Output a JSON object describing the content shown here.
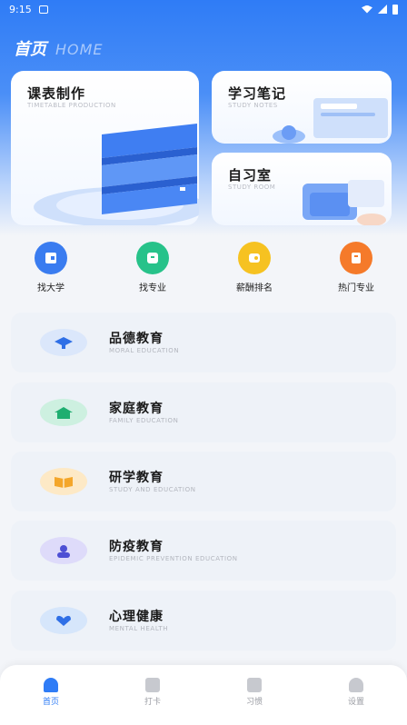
{
  "status": {
    "time": "9:15"
  },
  "header": {
    "title": "首页",
    "title_en": "HOME"
  },
  "cards": {
    "timetable": {
      "title": "课表制作",
      "subtitle": "TIMETABLE PRODUCTION"
    },
    "notes": {
      "title": "学习笔记",
      "subtitle": "STUDY NOTES"
    },
    "room": {
      "title": "自习室",
      "subtitle": "STUDY ROOM"
    }
  },
  "quick": [
    {
      "label": "找大学",
      "color": "#3a7cf0"
    },
    {
      "label": "找专业",
      "color": "#27c28a"
    },
    {
      "label": "薪酬排名",
      "color": "#f6c221"
    },
    {
      "label": "热门专业",
      "color": "#f57a2a"
    }
  ],
  "list": [
    {
      "title": "品德教育",
      "subtitle": "MORAL EDUCATION",
      "color": "#dbe7fb"
    },
    {
      "title": "家庭教育",
      "subtitle": "FAMILY EDUCATION",
      "color": "#cdf0e0"
    },
    {
      "title": "研学教育",
      "subtitle": "STUDY AND EDUCATION",
      "color": "#fde9c6"
    },
    {
      "title": "防疫教育",
      "subtitle": "EPIDEMIC PREVENTION EDUCATION",
      "color": "#dedbfa"
    },
    {
      "title": "心理健康",
      "subtitle": "MENTAL HEALTH",
      "color": "#d6e6fb"
    }
  ],
  "tabs": [
    {
      "label": "首页"
    },
    {
      "label": "打卡"
    },
    {
      "label": "习惯"
    },
    {
      "label": "设置"
    }
  ]
}
